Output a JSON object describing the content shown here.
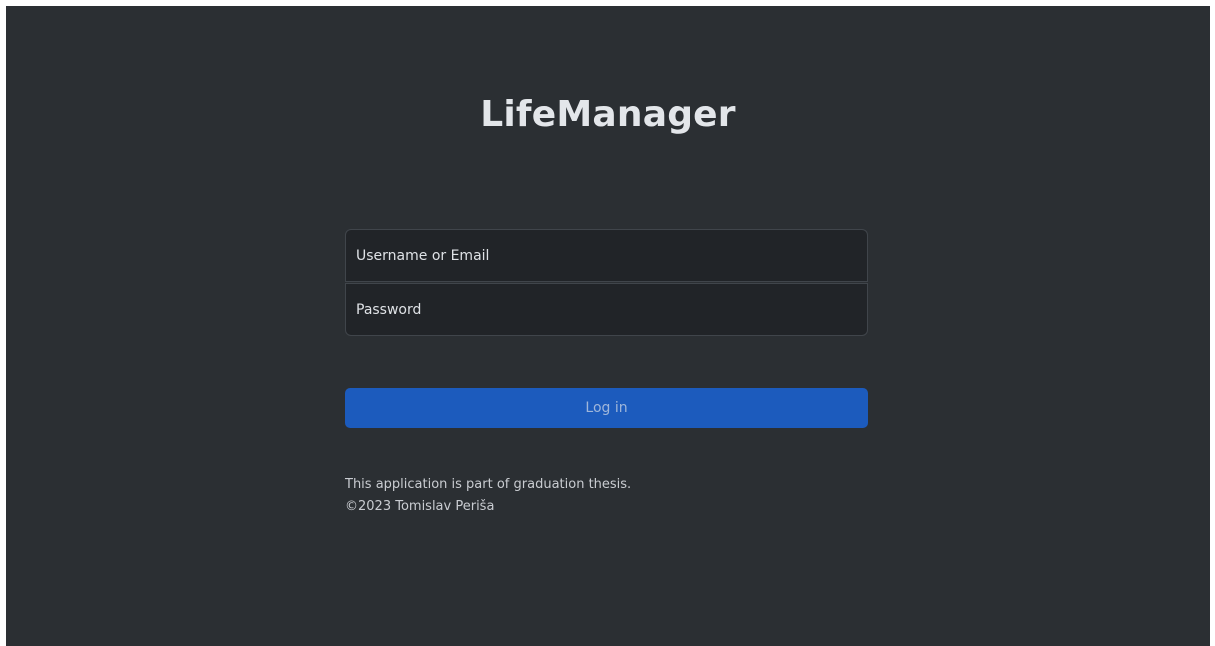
{
  "app": {
    "title": "LifeManager"
  },
  "login_form": {
    "username_placeholder": "Username or Email",
    "password_placeholder": "Password",
    "login_button_label": "Log in"
  },
  "footer": {
    "line1": "This application is part of graduation thesis.",
    "line2": "©2023 Tomislav Periša"
  },
  "colors": {
    "background": "#2b2f33",
    "input_background": "#212428",
    "primary_button": "#1c5bbd"
  }
}
